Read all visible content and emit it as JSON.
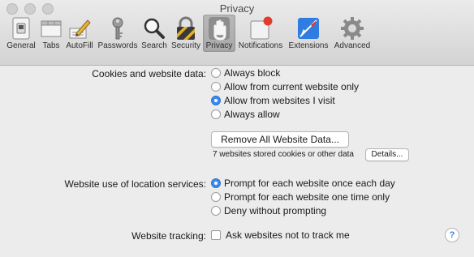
{
  "window": {
    "title": "Privacy"
  },
  "toolbar": {
    "items": [
      {
        "label": "General",
        "icon": "general-switch-icon"
      },
      {
        "label": "Tabs",
        "icon": "tabs-icon"
      },
      {
        "label": "AutoFill",
        "icon": "autofill-pencil-icon"
      },
      {
        "label": "Passwords",
        "icon": "key-icon"
      },
      {
        "label": "Search",
        "icon": "magnifier-icon"
      },
      {
        "label": "Security",
        "icon": "padlock-icon"
      },
      {
        "label": "Privacy",
        "icon": "hand-icon",
        "selected": true
      },
      {
        "label": "Notifications",
        "icon": "notifications-icon"
      },
      {
        "label": "Extensions",
        "icon": "extensions-icon"
      },
      {
        "label": "Advanced",
        "icon": "gear-icon"
      }
    ]
  },
  "cookies": {
    "label": "Cookies and website data:",
    "options": [
      {
        "label": "Always block",
        "selected": false
      },
      {
        "label": "Allow from current website only",
        "selected": false
      },
      {
        "label": "Allow from websites I visit",
        "selected": true
      },
      {
        "label": "Always allow",
        "selected": false
      }
    ],
    "remove_button": "Remove All Website Data...",
    "stored_text": "7 websites stored cookies or other data",
    "details_button": "Details..."
  },
  "location": {
    "label": "Website use of location services:",
    "options": [
      {
        "label": "Prompt for each website once each day",
        "selected": true
      },
      {
        "label": "Prompt for each website one time only",
        "selected": false
      },
      {
        "label": "Deny without prompting",
        "selected": false
      }
    ]
  },
  "tracking": {
    "label": "Website tracking:",
    "checkbox_label": "Ask websites not to track me",
    "checked": false
  },
  "help": {
    "label": "?"
  },
  "colors": {
    "accent": "#3b8af0",
    "background": "#ececec"
  }
}
